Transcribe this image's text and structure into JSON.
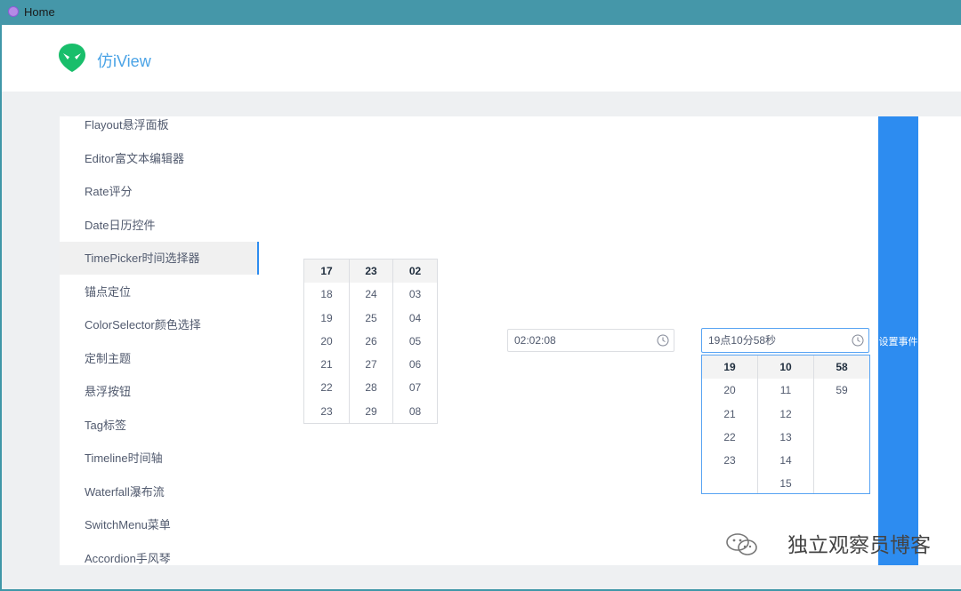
{
  "window": {
    "title": "Home"
  },
  "header": {
    "brand": "仿iView"
  },
  "sidebar": {
    "items": [
      {
        "label": "Flayout悬浮面板"
      },
      {
        "label": "Editor富文本编辑器"
      },
      {
        "label": "Rate评分"
      },
      {
        "label": "Date日历控件"
      },
      {
        "label": "TimePicker时间选择器"
      },
      {
        "label": "锚点定位"
      },
      {
        "label": "ColorSelector颜色选择"
      },
      {
        "label": "定制主题"
      },
      {
        "label": "悬浮按钮"
      },
      {
        "label": "Tag标签"
      },
      {
        "label": "Timeline时间轴"
      },
      {
        "label": "Waterfall瀑布流"
      },
      {
        "label": "SwitchMenu菜单"
      },
      {
        "label": "Accordion手风琴"
      }
    ],
    "active_index": 4
  },
  "picker1": {
    "columns": [
      [
        "17",
        "18",
        "19",
        "20",
        "21",
        "22",
        "23"
      ],
      [
        "23",
        "24",
        "25",
        "26",
        "27",
        "28",
        "29"
      ],
      [
        "02",
        "03",
        "04",
        "05",
        "06",
        "07",
        "08"
      ]
    ]
  },
  "input1": {
    "value": "02:02:08"
  },
  "input2": {
    "value": "19点10分58秒"
  },
  "picker2": {
    "columns": [
      [
        "19",
        "20",
        "21",
        "22",
        "23"
      ],
      [
        "10",
        "11",
        "12",
        "13",
        "14",
        "15"
      ],
      [
        "58",
        "59"
      ]
    ]
  },
  "button": {
    "label": "设置事件"
  },
  "watermark": {
    "text": "独立观察员博客"
  },
  "icons": {
    "app": "app-icon",
    "logo": "alien-logo-icon",
    "clock": "clock-icon",
    "wechat": "wechat-icon"
  },
  "colors": {
    "accent": "#2d8cf0",
    "brand": "#19be6b",
    "titlebar": "#4597a9"
  }
}
